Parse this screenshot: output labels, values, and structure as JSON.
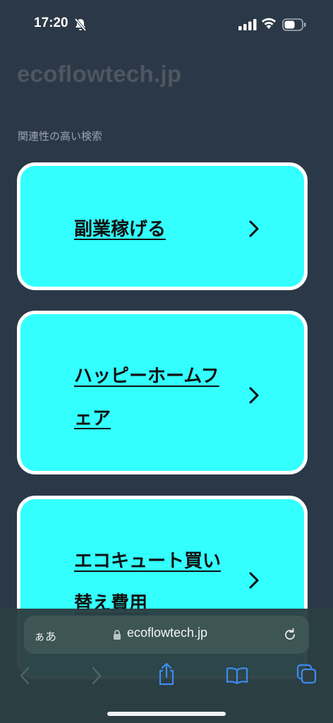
{
  "status": {
    "time": "17:20"
  },
  "site": {
    "title": "ecoflowtech.jp"
  },
  "section": {
    "label": "関連性の高い検索"
  },
  "cards": [
    {
      "lines": [
        "副業稼げる"
      ]
    },
    {
      "lines": [
        "ハッピーホームフ",
        "ェア"
      ]
    },
    {
      "lines": [
        "エコキュート買い",
        "替え費用"
      ]
    }
  ],
  "browser": {
    "text_size_label": "ぁあ",
    "url": "ecoflowtech.jp"
  },
  "colors": {
    "card_bg": "#33ffff",
    "page_bg": "#2b3847",
    "accent": "#3d8bf0"
  },
  "icons": [
    "bell-slash-icon",
    "signal-icon",
    "wifi-icon",
    "battery-icon",
    "chevron-right-icon",
    "lock-icon",
    "reload-icon",
    "back-icon",
    "forward-icon",
    "share-icon",
    "bookmarks-icon",
    "tabs-icon"
  ]
}
